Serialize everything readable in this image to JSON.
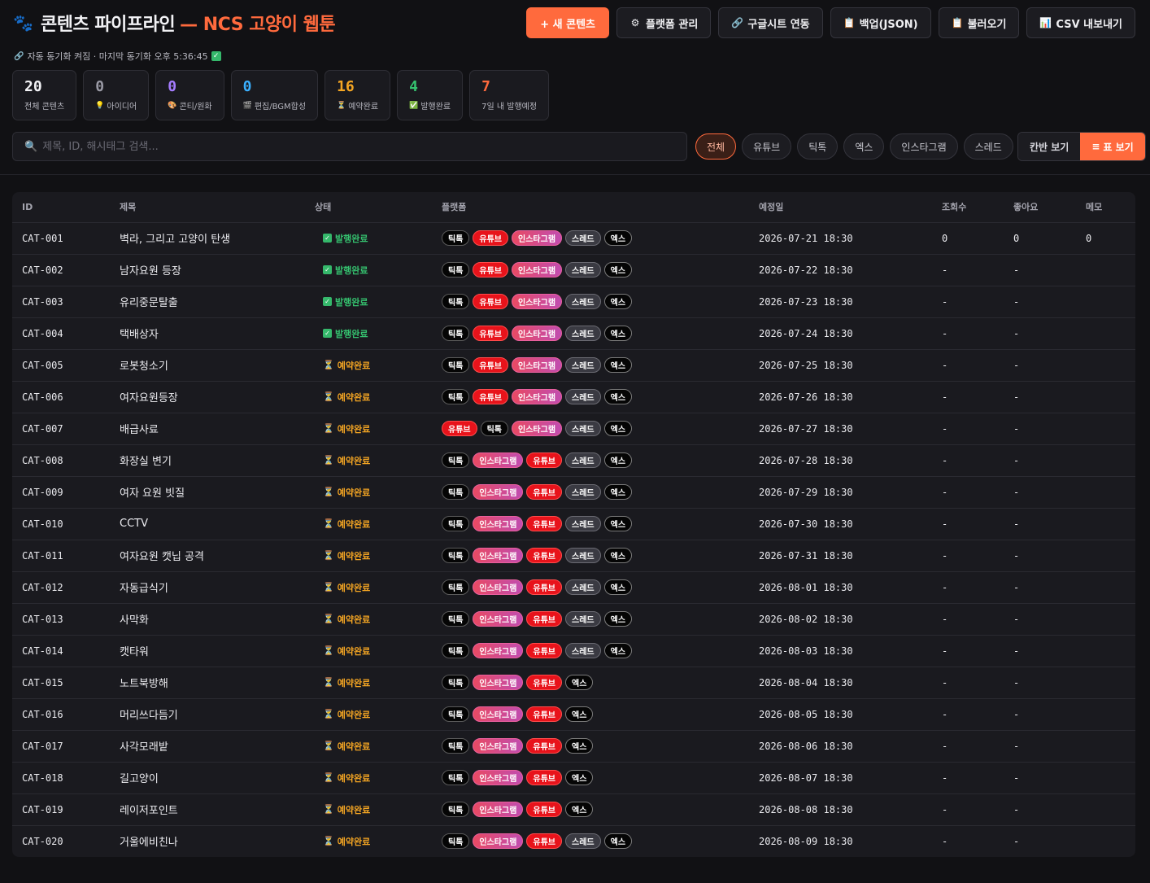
{
  "header": {
    "logo_icon": "paw-icon",
    "title": "콘텐츠 파이프라인",
    "subtitle": "— NCS 고양이 웹툰",
    "buttons": [
      {
        "name": "new-content-button",
        "icon": "plus-icon",
        "glyph": "",
        "label": "+ 새 콘텐츠",
        "primary": true
      },
      {
        "name": "platform-manage-button",
        "icon": "gear-icon",
        "glyph": "⚙",
        "label": "플랫폼 관리"
      },
      {
        "name": "google-sheet-sync-button",
        "icon": "link-icon",
        "glyph": "🔗",
        "label": "구글시트 연동"
      },
      {
        "name": "backup-json-button",
        "icon": "clipboard-icon",
        "glyph": "📋",
        "label": "백업(JSON)"
      },
      {
        "name": "load-button",
        "icon": "clipboard-icon",
        "glyph": "📋",
        "label": "불러오기"
      },
      {
        "name": "csv-export-button",
        "icon": "chart-icon",
        "glyph": "📊",
        "label": "CSV 내보내기"
      }
    ]
  },
  "sync": {
    "icon": "link-icon",
    "text": "자동 동기화 켜짐 · 마지막 동기화 오후 5:36:45"
  },
  "stats": [
    {
      "num": "20",
      "label": "전체 콘텐츠",
      "icon": "",
      "color": "#f2f2f5"
    },
    {
      "num": "0",
      "label": "아이디어",
      "icon": "💡",
      "color": "#9a9aa5"
    },
    {
      "num": "0",
      "label": "콘티/원화",
      "icon": "🎨",
      "color": "#a57cff"
    },
    {
      "num": "0",
      "label": "편집/BGM합성",
      "icon": "🎬",
      "color": "#3ab0ff"
    },
    {
      "num": "16",
      "label": "예약완료",
      "icon": "⏳",
      "color": "#f5a623"
    },
    {
      "num": "4",
      "label": "발행완료",
      "icon": "✅",
      "color": "#35c26f"
    },
    {
      "num": "7",
      "label": "7일 내 발행예정",
      "icon": "",
      "color": "#ff6a3d"
    }
  ],
  "search": {
    "placeholder": "제목, ID, 해시태그 검색..."
  },
  "filters": [
    "전체",
    "유튜브",
    "틱톡",
    "엑스",
    "인스타그램",
    "스레드"
  ],
  "active_filter": "전체",
  "views": [
    {
      "label": "칸반 보기",
      "icon": ""
    },
    {
      "label": "표 보기",
      "icon": "≡"
    }
  ],
  "active_view": "표 보기",
  "platform_labels": {
    "tiktok": "틱톡",
    "youtube": "유튜브",
    "instagram": "인스타그램",
    "threads": "스레드",
    "x": "엑스"
  },
  "status_labels": {
    "done": "발행완료",
    "sched": "예약완료"
  },
  "table": {
    "columns": [
      "ID",
      "제목",
      "상태",
      "플랫폼",
      "예정일",
      "조회수",
      "좋아요",
      "메모"
    ],
    "rows": [
      {
        "id": "CAT-001",
        "title": "벽라, 그리고 고양이 탄생",
        "status": "done",
        "platforms": [
          "tiktok",
          "youtube",
          "instagram",
          "threads",
          "x"
        ],
        "date": "2026-07-21 18:30",
        "views": "0",
        "likes": "0",
        "memo": "0"
      },
      {
        "id": "CAT-002",
        "title": "남자요원 등장",
        "status": "done",
        "platforms": [
          "tiktok",
          "youtube",
          "instagram",
          "threads",
          "x"
        ],
        "date": "2026-07-22 18:30",
        "views": "-",
        "likes": "-",
        "memo": ""
      },
      {
        "id": "CAT-003",
        "title": "유리중문탈출",
        "status": "done",
        "platforms": [
          "tiktok",
          "youtube",
          "instagram",
          "threads",
          "x"
        ],
        "date": "2026-07-23 18:30",
        "views": "-",
        "likes": "-",
        "memo": ""
      },
      {
        "id": "CAT-004",
        "title": "택배상자",
        "status": "done",
        "platforms": [
          "tiktok",
          "youtube",
          "instagram",
          "threads",
          "x"
        ],
        "date": "2026-07-24 18:30",
        "views": "-",
        "likes": "-",
        "memo": ""
      },
      {
        "id": "CAT-005",
        "title": "로봇청소기",
        "status": "sched",
        "platforms": [
          "tiktok",
          "youtube",
          "instagram",
          "threads",
          "x"
        ],
        "date": "2026-07-25 18:30",
        "views": "-",
        "likes": "-",
        "memo": ""
      },
      {
        "id": "CAT-006",
        "title": "여자요원등장",
        "status": "sched",
        "platforms": [
          "tiktok",
          "youtube",
          "instagram",
          "threads",
          "x"
        ],
        "date": "2026-07-26 18:30",
        "views": "-",
        "likes": "-",
        "memo": ""
      },
      {
        "id": "CAT-007",
        "title": "배급사료",
        "status": "sched",
        "platforms": [
          "youtube",
          "tiktok",
          "instagram",
          "threads",
          "x"
        ],
        "date": "2026-07-27 18:30",
        "views": "-",
        "likes": "-",
        "memo": ""
      },
      {
        "id": "CAT-008",
        "title": "화장실 변기",
        "status": "sched",
        "platforms": [
          "tiktok",
          "instagram",
          "youtube",
          "threads",
          "x"
        ],
        "date": "2026-07-28 18:30",
        "views": "-",
        "likes": "-",
        "memo": ""
      },
      {
        "id": "CAT-009",
        "title": "여자 요원 빗질",
        "status": "sched",
        "platforms": [
          "tiktok",
          "instagram",
          "youtube",
          "threads",
          "x"
        ],
        "date": "2026-07-29 18:30",
        "views": "-",
        "likes": "-",
        "memo": ""
      },
      {
        "id": "CAT-010",
        "title": "CCTV",
        "status": "sched",
        "platforms": [
          "tiktok",
          "instagram",
          "youtube",
          "threads",
          "x"
        ],
        "date": "2026-07-30 18:30",
        "views": "-",
        "likes": "-",
        "memo": ""
      },
      {
        "id": "CAT-011",
        "title": "여자요원 캣닙 공격",
        "status": "sched",
        "platforms": [
          "tiktok",
          "instagram",
          "youtube",
          "threads",
          "x"
        ],
        "date": "2026-07-31 18:30",
        "views": "-",
        "likes": "-",
        "memo": ""
      },
      {
        "id": "CAT-012",
        "title": "자동급식기",
        "status": "sched",
        "platforms": [
          "tiktok",
          "instagram",
          "youtube",
          "threads",
          "x"
        ],
        "date": "2026-08-01 18:30",
        "views": "-",
        "likes": "-",
        "memo": ""
      },
      {
        "id": "CAT-013",
        "title": "사막화",
        "status": "sched",
        "platforms": [
          "tiktok",
          "instagram",
          "youtube",
          "threads",
          "x"
        ],
        "date": "2026-08-02 18:30",
        "views": "-",
        "likes": "-",
        "memo": ""
      },
      {
        "id": "CAT-014",
        "title": "캣타워",
        "status": "sched",
        "platforms": [
          "tiktok",
          "instagram",
          "youtube",
          "threads",
          "x"
        ],
        "date": "2026-08-03 18:30",
        "views": "-",
        "likes": "-",
        "memo": ""
      },
      {
        "id": "CAT-015",
        "title": "노트북방해",
        "status": "sched",
        "platforms": [
          "tiktok",
          "instagram",
          "youtube",
          "x"
        ],
        "date": "2026-08-04 18:30",
        "views": "-",
        "likes": "-",
        "memo": ""
      },
      {
        "id": "CAT-016",
        "title": "머리쓰다듬기",
        "status": "sched",
        "platforms": [
          "tiktok",
          "instagram",
          "youtube",
          "x"
        ],
        "date": "2026-08-05 18:30",
        "views": "-",
        "likes": "-",
        "memo": ""
      },
      {
        "id": "CAT-017",
        "title": "사각모래밭",
        "status": "sched",
        "platforms": [
          "tiktok",
          "instagram",
          "youtube",
          "x"
        ],
        "date": "2026-08-06 18:30",
        "views": "-",
        "likes": "-",
        "memo": ""
      },
      {
        "id": "CAT-018",
        "title": "길고양이",
        "status": "sched",
        "platforms": [
          "tiktok",
          "instagram",
          "youtube",
          "x"
        ],
        "date": "2026-08-07 18:30",
        "views": "-",
        "likes": "-",
        "memo": ""
      },
      {
        "id": "CAT-019",
        "title": "레이저포인트",
        "status": "sched",
        "platforms": [
          "tiktok",
          "instagram",
          "youtube",
          "x"
        ],
        "date": "2026-08-08 18:30",
        "views": "-",
        "likes": "-",
        "memo": ""
      },
      {
        "id": "CAT-020",
        "title": "거울에비친나",
        "status": "sched",
        "platforms": [
          "tiktok",
          "instagram",
          "youtube",
          "threads",
          "x"
        ],
        "date": "2026-08-09 18:30",
        "views": "-",
        "likes": "-",
        "memo": ""
      }
    ]
  }
}
